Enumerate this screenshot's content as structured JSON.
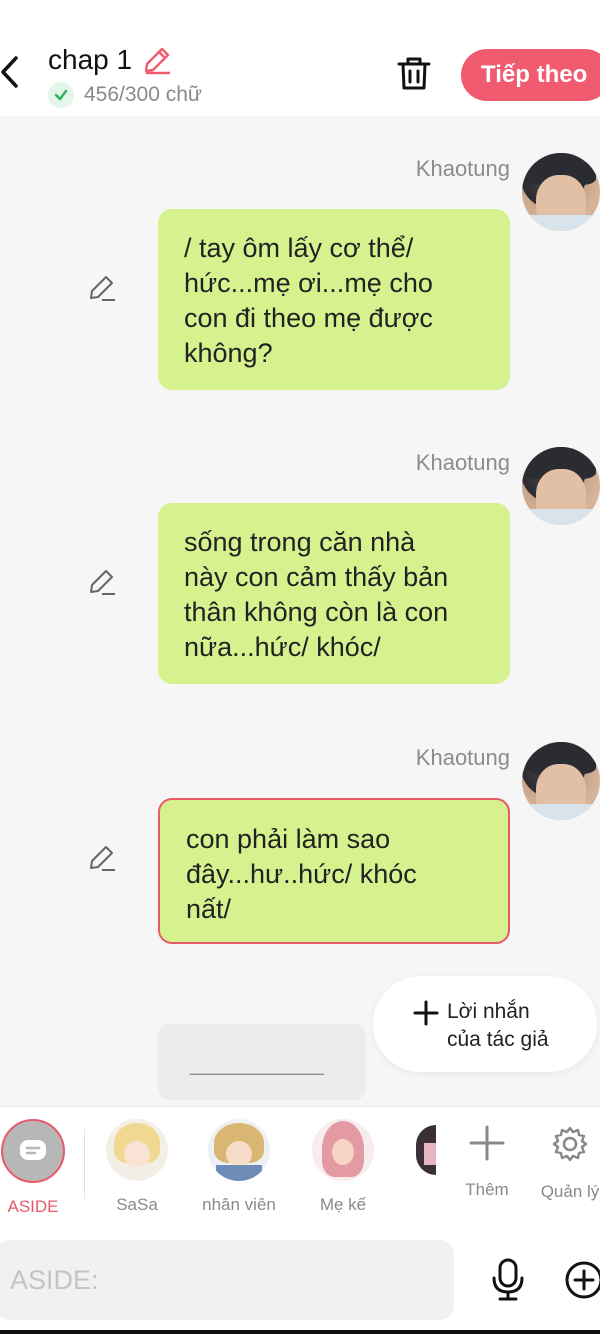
{
  "header": {
    "title": "chap 1",
    "word_count": "456/300 chữ",
    "next_label": "Tiếp theo",
    "accent": "#f15b6f"
  },
  "messages": [
    {
      "sender": "Khaotung",
      "text_lines": [
        "/ tay ôm lấy cơ thể/",
        "hức...mẹ ơi...mẹ cho",
        "con đi theo mẹ được",
        "không?"
      ],
      "selected": false
    },
    {
      "sender": "Khaotung",
      "text_lines": [
        "sống trong căn nhà",
        "này con cảm thấy bản",
        "thân không còn là con",
        "nữa...hức/ khóc/"
      ],
      "selected": false
    },
    {
      "sender": "Khaotung",
      "text_lines": [
        "con phải làm sao",
        "đây...hư..hức/ khóc",
        "nất/"
      ],
      "selected": true
    }
  ],
  "placeholder_text": "____________",
  "author_note": {
    "line1": "Lời nhắn",
    "line2": "của tác giả"
  },
  "characters": [
    {
      "label": "ASIDE",
      "active": true
    },
    {
      "label": "SaSa",
      "active": false
    },
    {
      "label": "nhân viên",
      "active": false
    },
    {
      "label": "Mẹ kế",
      "active": false
    }
  ],
  "tools": {
    "add_label": "Thêm",
    "manage_label": "Quản lý"
  },
  "input": {
    "placeholder": "ASIDE:"
  },
  "colors": {
    "bubble": "#d6f28f",
    "selected_border": "#e85a6a",
    "background": "#f6f6f6"
  },
  "icons": [
    "back-icon",
    "pencil-icon",
    "check-icon",
    "trash-icon",
    "edit-icon",
    "plus-icon",
    "gear-icon",
    "mic-icon",
    "add-circle-icon",
    "chat-icon"
  ]
}
